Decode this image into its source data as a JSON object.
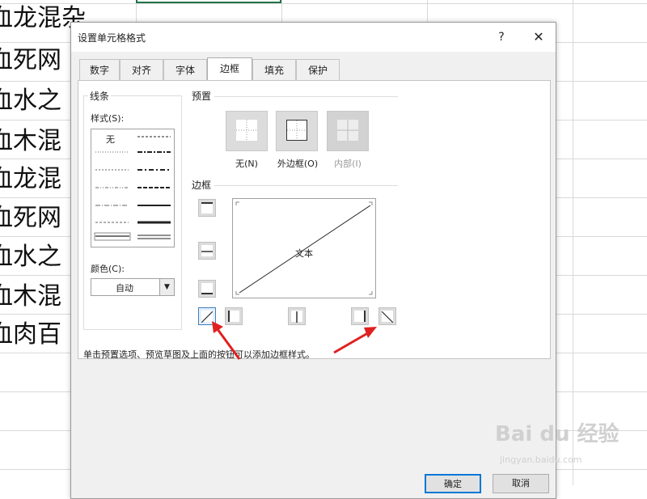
{
  "sheet": {
    "rows": [
      "血龙混杂",
      "血死网",
      "血水之",
      "血木混",
      "血龙混",
      "血死网",
      "血水之",
      "血木混",
      "血肉百"
    ]
  },
  "dialog": {
    "title": "设置单元格格式",
    "help_label": "?",
    "close_label": "✕",
    "tabs": [
      {
        "label": "数字"
      },
      {
        "label": "对齐"
      },
      {
        "label": "字体"
      },
      {
        "label": "边框",
        "active": true
      },
      {
        "label": "填充"
      },
      {
        "label": "保护"
      }
    ],
    "line_group": {
      "title": "线条",
      "style_label": "样式(S):",
      "none_label": "无",
      "color_label": "颜色(C):",
      "color_value": "自动"
    },
    "preset_group": {
      "title": "预置",
      "buttons": [
        {
          "label": "无(N)",
          "enabled": true
        },
        {
          "label": "外边框(O)",
          "enabled": true
        },
        {
          "label": "内部(I)",
          "enabled": false
        }
      ]
    },
    "border_group": {
      "title": "边框",
      "preview_text": "文本",
      "selected_button": "diagonal-up"
    },
    "hint": "单击预置选项、预览草图及上面的按钮可以添加边框样式。",
    "ok_label": "确定",
    "cancel_label": "取消"
  },
  "watermark": {
    "text": "Bai du 经验",
    "sub": "jingyan.baidu.com"
  },
  "colors": {
    "accent": "#0078d7",
    "arrow": "#e02020",
    "excel_green": "#217346"
  }
}
